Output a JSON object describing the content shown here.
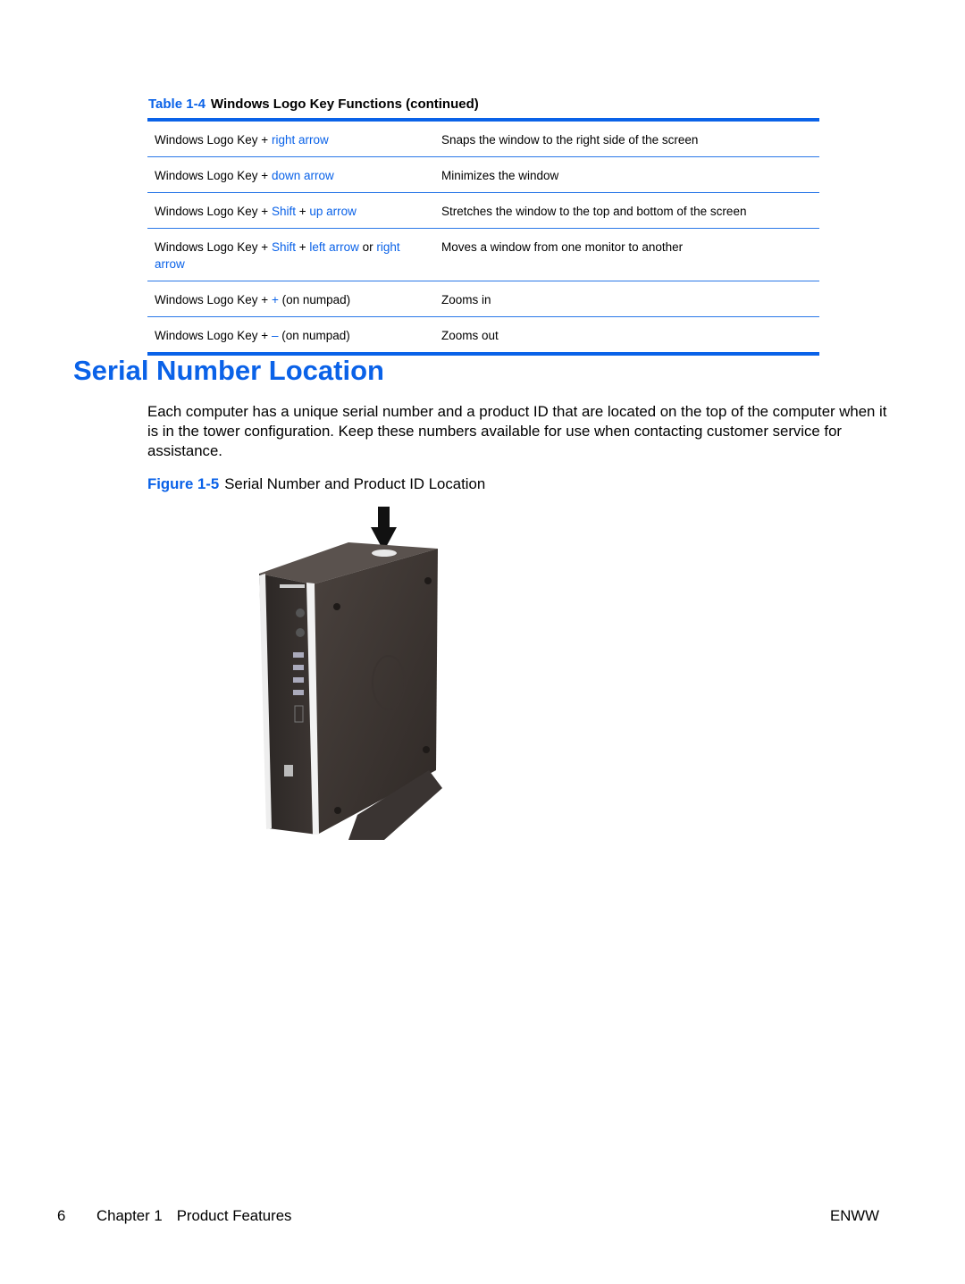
{
  "table": {
    "label": "Table 1-4",
    "title": "Windows Logo Key Functions (continued)",
    "rows": [
      {
        "key_parts": [
          {
            "text": "Windows Logo Key + ",
            "style": "plain"
          },
          {
            "text": "right arrow",
            "style": "link"
          }
        ],
        "function": "Snaps the window to the right side of the screen"
      },
      {
        "key_parts": [
          {
            "text": "Windows Logo Key + ",
            "style": "plain"
          },
          {
            "text": "down arrow",
            "style": "link"
          }
        ],
        "function": "Minimizes the window"
      },
      {
        "key_parts": [
          {
            "text": "Windows Logo Key + ",
            "style": "plain"
          },
          {
            "text": "Shift",
            "style": "link"
          },
          {
            "text": " + ",
            "style": "plain"
          },
          {
            "text": "up arrow",
            "style": "link"
          }
        ],
        "function": "Stretches the window to the top and bottom of the screen"
      },
      {
        "key_parts": [
          {
            "text": "Windows Logo Key + ",
            "style": "plain"
          },
          {
            "text": "Shift",
            "style": "link"
          },
          {
            "text": " + ",
            "style": "plain"
          },
          {
            "text": "left arrow",
            "style": "link"
          },
          {
            "text": " or ",
            "style": "plain"
          },
          {
            "text": "right arrow",
            "style": "link"
          }
        ],
        "function": "Moves a window from one monitor to another"
      },
      {
        "key_parts": [
          {
            "text": "Windows Logo Key + ",
            "style": "plain"
          },
          {
            "text": "+",
            "style": "link"
          },
          {
            "text": " (on numpad)",
            "style": "plain"
          }
        ],
        "function": "Zooms in"
      },
      {
        "key_parts": [
          {
            "text": "Windows Logo Key + ",
            "style": "plain"
          },
          {
            "text": "–",
            "style": "link"
          },
          {
            "text": " (on numpad)",
            "style": "plain"
          }
        ],
        "function": "Zooms out"
      }
    ]
  },
  "section": {
    "title": "Serial Number Location",
    "paragraph": "Each computer has a unique serial number and a product ID that are located on the top of the computer when it is in the tower configuration. Keep these numbers available for use when contacting customer service for assistance."
  },
  "figure": {
    "label": "Figure 1-5",
    "caption": "Serial Number and Product ID Location",
    "image_description": "HP compact desktop computer in tower configuration with arrow pointing to label on top"
  },
  "footer": {
    "page_number": "6",
    "chapter": "Chapter 1",
    "chapter_title": "Product Features",
    "locale": "ENWW"
  },
  "colors": {
    "accent": "#0a62e8"
  }
}
